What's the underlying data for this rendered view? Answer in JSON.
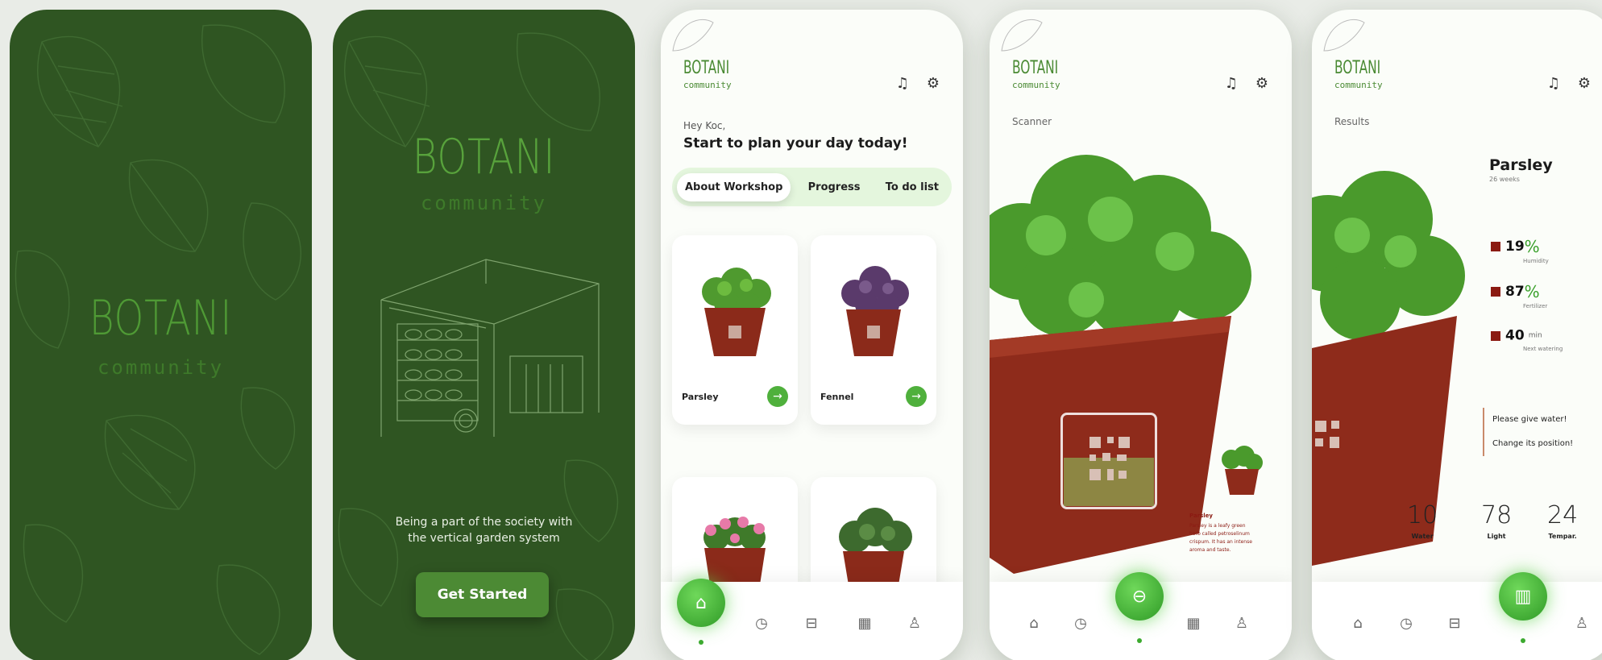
{
  "splash": {
    "logo": "BOTANI",
    "logo_sub": "community"
  },
  "onboarding": {
    "logo": "BOTANI",
    "logo_sub": "community",
    "tagline_line1": "Being a part of the society with",
    "tagline_line2": "the vertical garden system",
    "cta": "Get Started"
  },
  "home": {
    "brand": "BOTANI",
    "brand_sub": "community",
    "greeting": "Hey Koc,",
    "headline": "Start to plan your day today!",
    "tabs": [
      "About Workshop",
      "Progress",
      "To do list"
    ],
    "cards": [
      {
        "label": "Parsley"
      },
      {
        "label": "Fennel"
      },
      {
        "label": ""
      },
      {
        "label": ""
      }
    ]
  },
  "scanner": {
    "brand": "BOTANI",
    "brand_sub": "community",
    "title": "Scanner",
    "info_title": "Parsley",
    "info_body": "Parsley is a leafy green herb called petroselinum crispum. It has an intense aroma and taste."
  },
  "results": {
    "brand": "BOTANI",
    "brand_sub": "community",
    "title": "Results",
    "plant_name": "Parsley",
    "plant_age": "26 weeks",
    "stats": [
      {
        "value": "19",
        "unit": "%",
        "caption": "Humidity"
      },
      {
        "value": "87",
        "unit": "%",
        "caption": "Fertilizer"
      },
      {
        "value": "40",
        "unit": "min",
        "caption": "Next watering"
      }
    ],
    "alerts": [
      "Please give water!",
      "Change its position!"
    ],
    "metrics": [
      {
        "value": "10",
        "caption": "Water"
      },
      {
        "value": "78",
        "caption": "Light"
      },
      {
        "value": "24",
        "caption": "Tempar."
      }
    ]
  },
  "colors": {
    "dark_green": "#2f5522",
    "accent_green": "#4fb03c",
    "pot_red": "#8b1a12"
  }
}
